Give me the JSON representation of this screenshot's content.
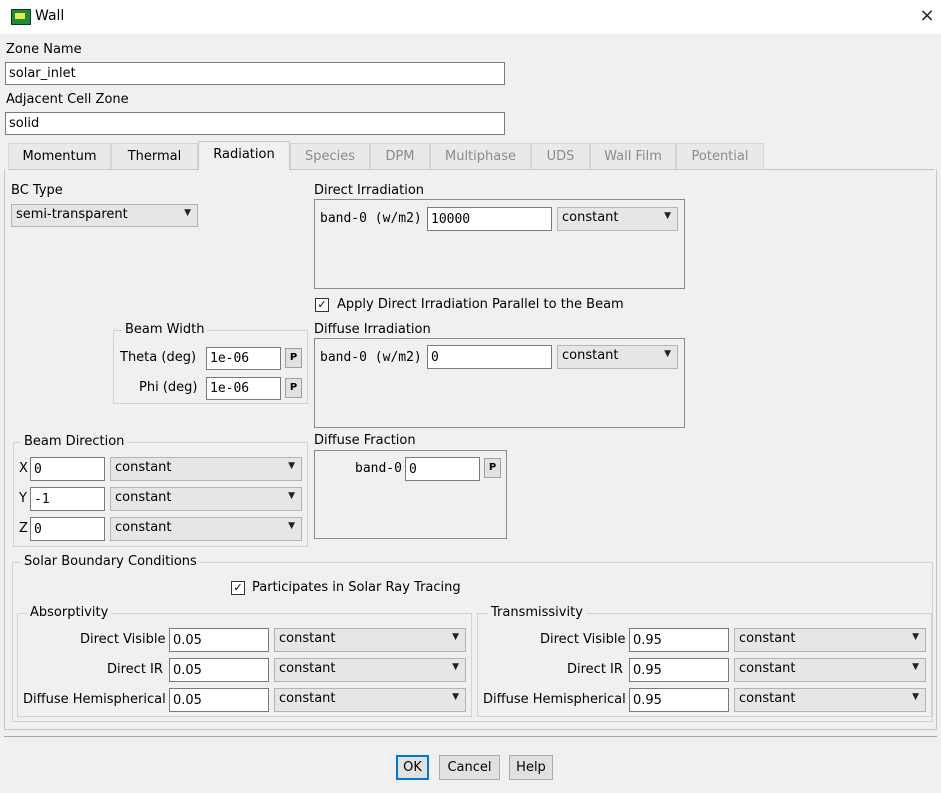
{
  "window": {
    "title": "Wall"
  },
  "zone": {
    "name_label": "Zone Name",
    "name_value": "solar_inlet",
    "adjacent_label": "Adjacent Cell Zone",
    "adjacent_value": "solid"
  },
  "tabs": [
    {
      "label": "Momentum",
      "enabled": true
    },
    {
      "label": "Thermal",
      "enabled": true
    },
    {
      "label": "Radiation",
      "enabled": true,
      "active": true
    },
    {
      "label": "Species",
      "enabled": false
    },
    {
      "label": "DPM",
      "enabled": false
    },
    {
      "label": "Multiphase",
      "enabled": false
    },
    {
      "label": "UDS",
      "enabled": false
    },
    {
      "label": "Wall Film",
      "enabled": false
    },
    {
      "label": "Potential",
      "enabled": false
    }
  ],
  "bc_type": {
    "label": "BC Type",
    "value": "semi-transparent"
  },
  "direct_irradiation": {
    "label": "Direct Irradiation",
    "band_label": "band-0 (w/m2)",
    "value": "10000",
    "method": "constant"
  },
  "apply_parallel": {
    "label": "Apply Direct Irradiation Parallel to the Beam",
    "checked": true
  },
  "beam_width": {
    "label": "Beam Width",
    "theta_label": "Theta (deg)",
    "theta_value": "1e-06",
    "phi_label": "Phi (deg)",
    "phi_value": "1e-06",
    "p_label": "P"
  },
  "diffuse_irradiation": {
    "label": "Diffuse Irradiation",
    "band_label": "band-0 (w/m2)",
    "value": "0",
    "method": "constant"
  },
  "beam_direction": {
    "label": "Beam Direction",
    "components": [
      {
        "axis": "X",
        "value": "0",
        "method": "constant"
      },
      {
        "axis": "Y",
        "value": "-1",
        "method": "constant"
      },
      {
        "axis": "Z",
        "value": "0",
        "method": "constant"
      }
    ]
  },
  "diffuse_fraction": {
    "label": "Diffuse Fraction",
    "band_label": "band-0",
    "value": "0",
    "p_label": "P"
  },
  "solar": {
    "label": "Solar Boundary Conditions",
    "ray_tracing_label": "Participates in Solar Ray Tracing",
    "ray_tracing_checked": true
  },
  "absorptivity": {
    "label": "Absorptivity",
    "rows": [
      {
        "label": "Direct Visible",
        "value": "0.05",
        "method": "constant"
      },
      {
        "label": "Direct IR",
        "value": "0.05",
        "method": "constant"
      },
      {
        "label": "Diffuse Hemispherical",
        "value": "0.05",
        "method": "constant"
      }
    ]
  },
  "transmissivity": {
    "label": "Transmissivity",
    "rows": [
      {
        "label": "Direct Visible",
        "value": "0.95",
        "method": "constant"
      },
      {
        "label": "Direct IR",
        "value": "0.95",
        "method": "constant"
      },
      {
        "label": "Diffuse Hemispherical",
        "value": "0.95",
        "method": "constant"
      }
    ]
  },
  "buttons": {
    "ok": "OK",
    "cancel": "Cancel",
    "help": "Help"
  },
  "icons": {
    "app": "fluent-app-icon",
    "close": "×",
    "caret": "▼",
    "check": "✓"
  }
}
